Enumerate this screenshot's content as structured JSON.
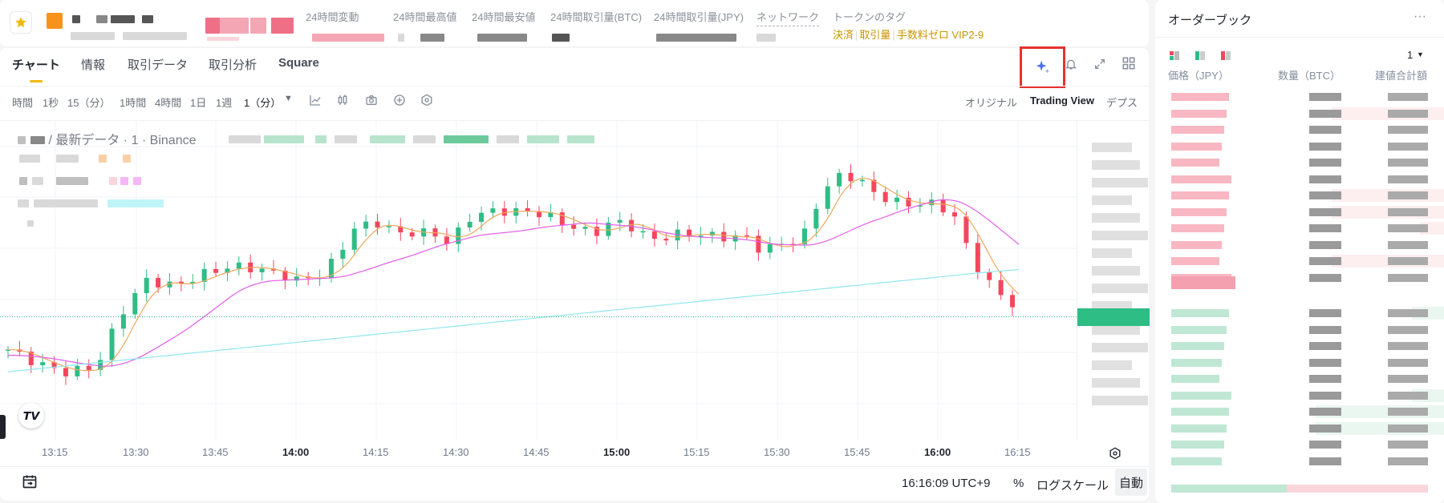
{
  "ticker": {
    "stats": [
      {
        "label": "24時間変動"
      },
      {
        "label": "24時間最高値"
      },
      {
        "label": "24時間最安値"
      },
      {
        "label": "24時間取引量(BTC)"
      },
      {
        "label": "24時間取引量(JPY)"
      },
      {
        "label": "ネットワーク"
      },
      {
        "label": "トークンのタグ"
      }
    ],
    "tags": [
      "決済",
      "取引量",
      "手数料ゼロ VIP2-9"
    ],
    "tag_separator": "|"
  },
  "tabs": [
    "チャート",
    "情報",
    "取引データ",
    "取引分析",
    "Square"
  ],
  "toolbar": {
    "intervals": [
      "時間",
      "1秒",
      "15（分）",
      "1時間",
      "4時間",
      "1日",
      "1週"
    ],
    "selected_interval": "1（分）",
    "views": [
      "オリジナル",
      "Trading View",
      "デプス"
    ],
    "active_view": "Trading View"
  },
  "chart_header": {
    "legend_text": "/ 最新データ · 1 · Binance"
  },
  "chart_data": {
    "type": "candlestick",
    "x_ticks": [
      "13:15",
      "13:30",
      "13:45",
      "14:00",
      "14:15",
      "14:30",
      "14:45",
      "15:00",
      "15:15",
      "15:30",
      "15:45",
      "16:00",
      "16:15"
    ],
    "bold_ticks": [
      "14:00",
      "15:00",
      "16:00"
    ],
    "y_range": [
      0,
      100
    ],
    "series": [
      {
        "kind": "candles",
        "count": 88
      },
      {
        "kind": "ma",
        "color": "#f0a85c"
      },
      {
        "kind": "ma",
        "color": "#e15ee6"
      },
      {
        "kind": "ma",
        "color": "#8fe6f0"
      }
    ],
    "colors": {
      "up": "#2ebd85",
      "down": "#f6465d"
    }
  },
  "footer": {
    "time": "16:16:09 UTC+9",
    "percent": "%",
    "log": "ログスケール",
    "auto": "自動"
  },
  "orderbook": {
    "title": "オーダーブック",
    "precision": "1",
    "columns": [
      "価格（JPY）",
      "数量（BTC）",
      "建値合計額"
    ]
  },
  "colors": {
    "accent": "#f0b90b",
    "up": "#2ebd85",
    "down": "#f6465d",
    "highlight": "#e8312f"
  }
}
